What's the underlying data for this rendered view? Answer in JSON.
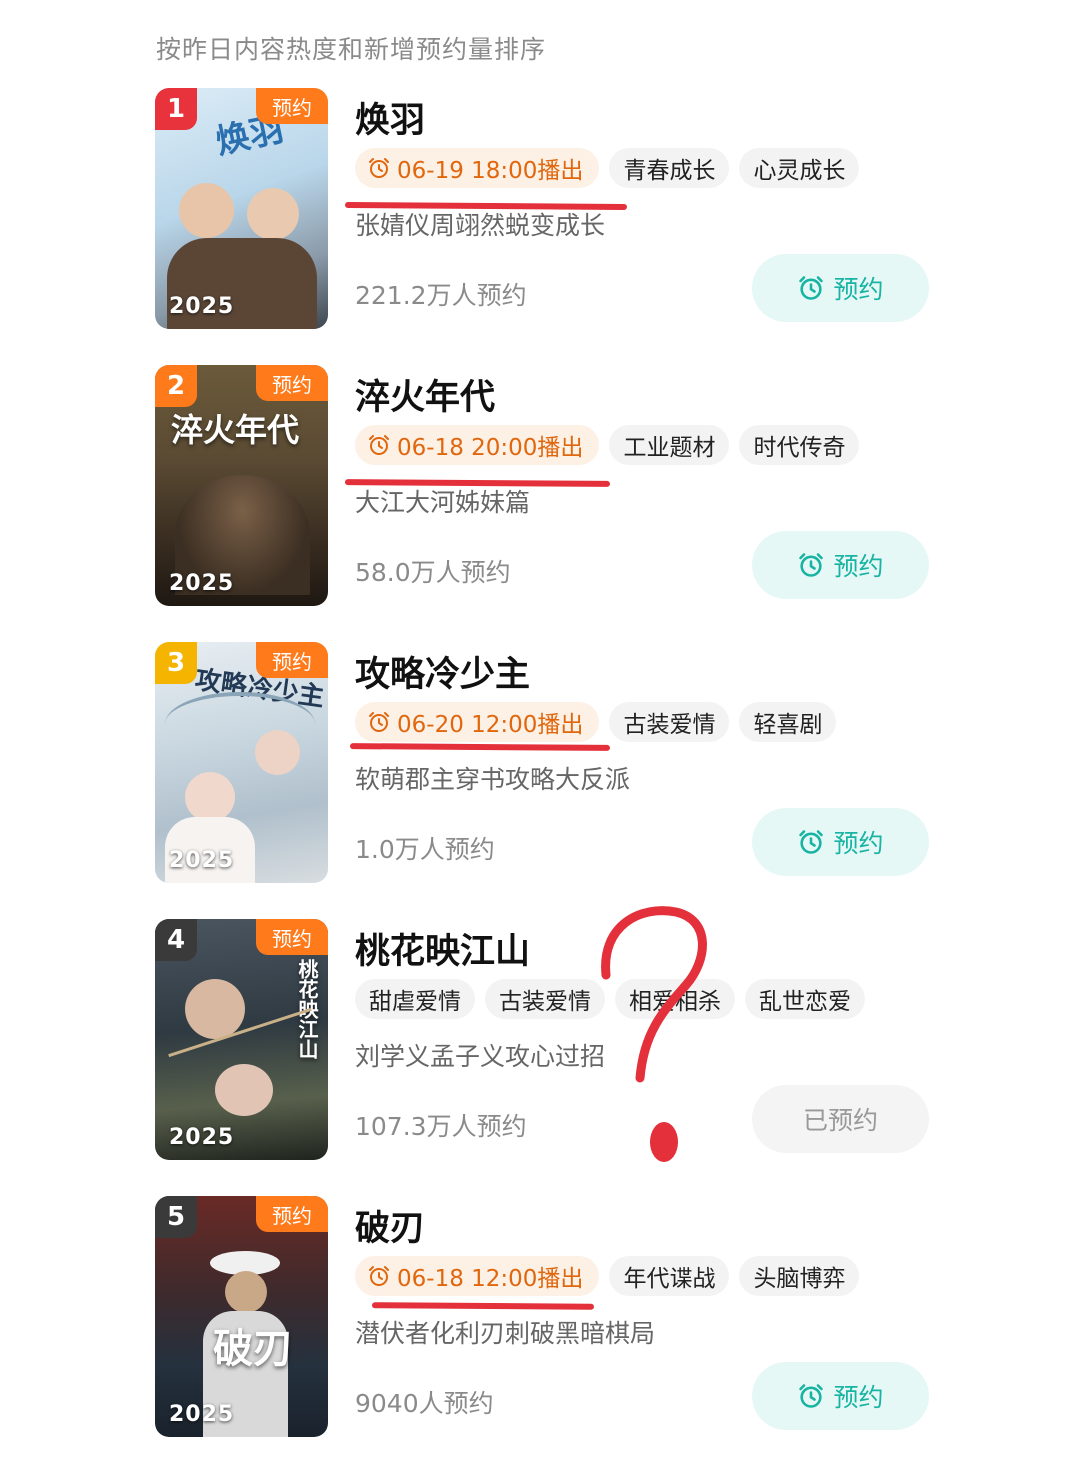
{
  "header": {
    "subtitle": "按昨日内容热度和新增预约量排序"
  },
  "items": [
    {
      "rank": "1",
      "rank_color": "#e8323c",
      "title": "焕羽",
      "poster_badge": "预约",
      "poster_year": "2025",
      "poster_text": "焕羽",
      "air_time": "06-19 18:00播出",
      "tags": [
        "青春成长",
        "心灵成长"
      ],
      "description": "张婧仪周翊然蜕变成长",
      "reservations": "221.2万人预约",
      "button": "预约",
      "button_state": "active"
    },
    {
      "rank": "2",
      "rank_color": "#ff7a1a",
      "title": "淬火年代",
      "poster_badge": "预约",
      "poster_year": "2025",
      "poster_text": "淬火年代",
      "air_time": "06-18 20:00播出",
      "tags": [
        "工业题材",
        "时代传奇"
      ],
      "description": "大江大河姊妹篇",
      "reservations": "58.0万人预约",
      "button": "预约",
      "button_state": "active"
    },
    {
      "rank": "3",
      "rank_color": "#f5b400",
      "title": "攻略冷少主",
      "poster_badge": "预约",
      "poster_year": "2025",
      "poster_text": "攻略冷少主",
      "air_time": "06-20 12:00播出",
      "tags": [
        "古装爱情",
        "轻喜剧"
      ],
      "description": "软萌郡主穿书攻略大反派",
      "reservations": "1.0万人预约",
      "button": "预约",
      "button_state": "active"
    },
    {
      "rank": "4",
      "rank_color": "#3a3a3a",
      "title": "桃花映江山",
      "poster_badge": "预约",
      "poster_year": "2025",
      "poster_text": "桃花映江山",
      "tags": [
        "甜虐爱情",
        "古装爱情",
        "相爱相杀",
        "乱世恋爱"
      ],
      "description": "刘学义孟子义攻心过招",
      "reservations": "107.3万人预约",
      "button": "已预约",
      "button_state": "done"
    },
    {
      "rank": "5",
      "rank_color": "#3a3a3a",
      "title": "破刃",
      "poster_badge": "预约",
      "poster_year": "2025",
      "poster_text": "破刃",
      "air_time": "06-18 12:00播出",
      "tags": [
        "年代谍战",
        "头脑博弈"
      ],
      "description": "潜伏者化利刃刺破黑暗棋局",
      "reservations": "9040人预约",
      "button": "预约",
      "button_state": "active"
    }
  ],
  "annotations": {
    "ink_color": "#e3303a",
    "question_mark": "?"
  }
}
